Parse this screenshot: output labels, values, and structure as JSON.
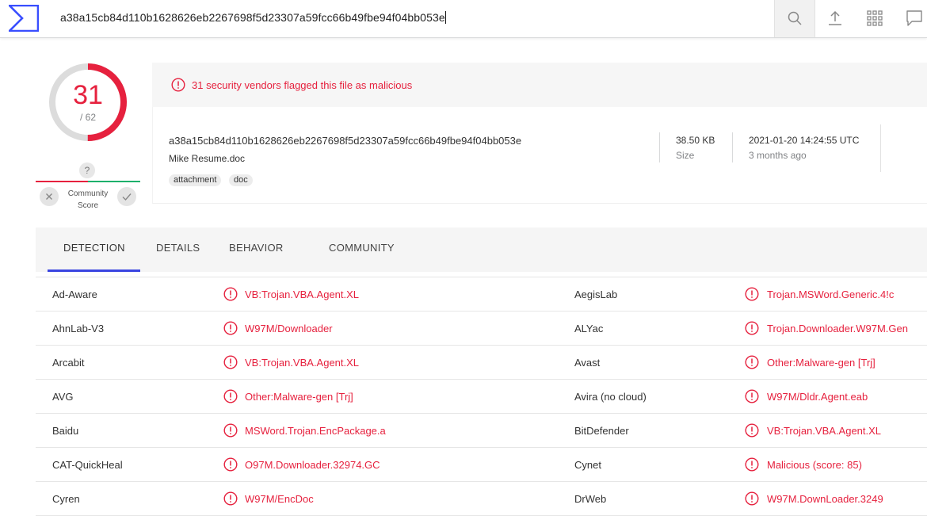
{
  "header": {
    "search_value": "a38a15cb84d110b1628626eb2267698f5d23307a59fcc66b49fbe94f04bb053e"
  },
  "score": {
    "detections": "31",
    "total": "/ 62",
    "community_unknown": "?",
    "community_label_line1": "Community",
    "community_label_line2": "Score"
  },
  "alert": {
    "text": "31 security vendors flagged this file as malicious"
  },
  "file": {
    "hash": "a38a15cb84d110b1628626eb2267698f5d23307a59fcc66b49fbe94f04bb053e",
    "name": "Mike Resume.doc",
    "tags": [
      "attachment",
      "doc"
    ],
    "size_value": "38.50 KB",
    "size_label": "Size",
    "date_value": "2021-01-20 14:24:55 UTC",
    "date_label": "3 months ago"
  },
  "tabs": [
    "DETECTION",
    "DETAILS",
    "BEHAVIOR",
    "COMMUNITY"
  ],
  "detections": [
    {
      "v1": "Ad-Aware",
      "r1": "VB:Trojan.VBA.Agent.XL",
      "v2": "AegisLab",
      "r2": "Trojan.MSWord.Generic.4!c"
    },
    {
      "v1": "AhnLab-V3",
      "r1": "W97M/Downloader",
      "v2": "ALYac",
      "r2": "Trojan.Downloader.W97M.Gen"
    },
    {
      "v1": "Arcabit",
      "r1": "VB:Trojan.VBA.Agent.XL",
      "v2": "Avast",
      "r2": "Other:Malware-gen [Trj]"
    },
    {
      "v1": "AVG",
      "r1": "Other:Malware-gen [Trj]",
      "v2": "Avira (no cloud)",
      "r2": "W97M/Dldr.Agent.eab"
    },
    {
      "v1": "Baidu",
      "r1": "MSWord.Trojan.EncPackage.a",
      "v2": "BitDefender",
      "r2": "VB:Trojan.VBA.Agent.XL"
    },
    {
      "v1": "CAT-QuickHeal",
      "r1": "O97M.Downloader.32974.GC",
      "v2": "Cynet",
      "r2": "Malicious (score: 85)"
    },
    {
      "v1": "Cyren",
      "r1": "W97M/EncDoc",
      "v2": "DrWeb",
      "r2": "W97M.DownLoader.3249"
    }
  ],
  "colors": {
    "malicious": "#e6213e",
    "accent": "#3a45e0",
    "harmless": "#1db06b"
  }
}
